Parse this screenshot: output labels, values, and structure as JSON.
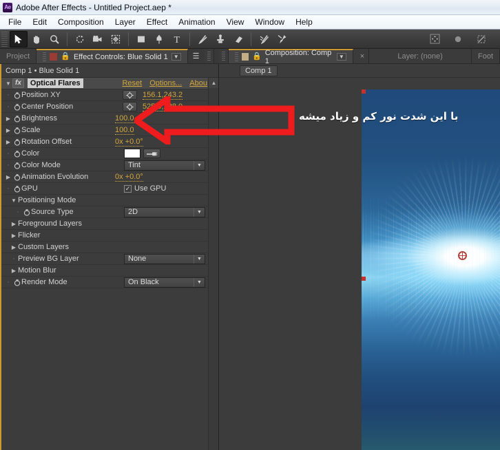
{
  "window": {
    "logo": "Ae",
    "logo_icon": "after-effects-logo-icon",
    "title": "Adobe After Effects - Untitled Project.aep *"
  },
  "menubar": {
    "items": [
      {
        "label": "File"
      },
      {
        "label": "Edit"
      },
      {
        "label": "Composition"
      },
      {
        "label": "Layer"
      },
      {
        "label": "Effect"
      },
      {
        "label": "Animation"
      },
      {
        "label": "View"
      },
      {
        "label": "Window"
      },
      {
        "label": "Help"
      }
    ]
  },
  "toolbar": {
    "tools": [
      {
        "name": "selection-tool-icon",
        "selected": true
      },
      {
        "name": "hand-tool-icon",
        "selected": false
      },
      {
        "name": "zoom-tool-icon",
        "selected": false
      },
      {
        "name": "rotation-tool-icon",
        "selected": false
      },
      {
        "name": "camera-orbit-tool-icon",
        "selected": false
      },
      {
        "name": "pan-behind-tool-icon",
        "selected": false
      },
      {
        "name": "shape-tool-icon",
        "selected": false
      },
      {
        "name": "pen-tool-icon",
        "selected": false
      },
      {
        "name": "type-tool-icon",
        "selected": false
      },
      {
        "name": "brush-tool-icon",
        "selected": false
      },
      {
        "name": "clone-stamp-tool-icon",
        "selected": false
      },
      {
        "name": "eraser-tool-icon",
        "selected": false
      },
      {
        "name": "roto-brush-tool-icon",
        "selected": false
      },
      {
        "name": "puppet-pin-tool-icon",
        "selected": false
      }
    ],
    "right_icons": [
      {
        "name": "transform-snapping-icon"
      },
      {
        "name": "grid-dot-icon"
      },
      {
        "name": "toggle-mask-icon"
      }
    ]
  },
  "left_panel": {
    "tabs": [
      {
        "label": "Project",
        "active": false,
        "name": "tab-project"
      },
      {
        "label": "Effect Controls: Blue Solid 1",
        "active": true,
        "name": "tab-effect-controls"
      }
    ],
    "breadcrumb": "Comp 1 • Blue Solid 1",
    "effect": {
      "name": "Optical Flares",
      "fx_badge": "fx",
      "twirl": "▼",
      "links": [
        {
          "label": "Reset"
        },
        {
          "label": "Options..."
        },
        {
          "label": "Abou"
        }
      ],
      "properties": [
        {
          "label": "Position XY",
          "indent": 1,
          "marker": "dot",
          "stopwatch": true,
          "control": "xy",
          "value": "156.1,243.2"
        },
        {
          "label": "Center Position",
          "indent": 1,
          "marker": "dot",
          "stopwatch": true,
          "control": "xy",
          "value": "525.0,288.0"
        },
        {
          "label": "Brightness",
          "indent": 1,
          "marker": "twirl",
          "stopwatch": true,
          "control": "value",
          "value": "100.0"
        },
        {
          "label": "Scale",
          "indent": 1,
          "marker": "twirl",
          "stopwatch": true,
          "control": "value",
          "value": "100.0"
        },
        {
          "label": "Rotation Offset",
          "indent": 1,
          "marker": "twirl",
          "stopwatch": true,
          "control": "value",
          "value": "0x +0.0°"
        },
        {
          "label": "Color",
          "indent": 1,
          "marker": "dot",
          "stopwatch": true,
          "control": "color",
          "value": "#ffffff"
        },
        {
          "label": "Color Mode",
          "indent": 1,
          "marker": "dot",
          "stopwatch": true,
          "control": "dropdown",
          "value": "Tint"
        },
        {
          "label": "Animation Evolution",
          "indent": 1,
          "marker": "twirl",
          "stopwatch": true,
          "control": "value",
          "value": "0x +0.0°"
        },
        {
          "label": "GPU",
          "indent": 1,
          "marker": "dot",
          "stopwatch": true,
          "control": "checkbox",
          "value": "Use GPU",
          "checked": true
        },
        {
          "label": "Positioning Mode",
          "indent": 0,
          "marker": "twirl-open",
          "stopwatch": false,
          "control": "none",
          "value": ""
        },
        {
          "label": "Source Type",
          "indent": 2,
          "marker": "dot",
          "stopwatch": true,
          "control": "dropdown",
          "value": "2D"
        },
        {
          "label": "Foreground Layers",
          "indent": 0,
          "marker": "twirl",
          "stopwatch": false,
          "control": "none",
          "value": ""
        },
        {
          "label": "Flicker",
          "indent": 0,
          "marker": "twirl",
          "stopwatch": false,
          "control": "none",
          "value": ""
        },
        {
          "label": "Custom Layers",
          "indent": 0,
          "marker": "twirl",
          "stopwatch": false,
          "control": "none",
          "value": ""
        },
        {
          "label": "Preview BG Layer",
          "indent": 0,
          "marker": "dot",
          "stopwatch": false,
          "control": "dropdown",
          "value": "None"
        },
        {
          "label": "Motion Blur",
          "indent": 0,
          "marker": "twirl",
          "stopwatch": false,
          "control": "none",
          "value": ""
        },
        {
          "label": "Render Mode",
          "indent": 1,
          "marker": "dot",
          "stopwatch": true,
          "control": "dropdown",
          "value": "On Black"
        }
      ]
    },
    "scrollbar": {
      "up_arrow": "▲"
    }
  },
  "right_panel": {
    "tabs": [
      {
        "label": "Composition: Comp 1",
        "active": true,
        "name": "tab-composition"
      },
      {
        "label": "Layer: (none)",
        "active": false,
        "name": "tab-layer"
      },
      {
        "label": "Foot",
        "active": false,
        "name": "tab-footage"
      }
    ],
    "close_glyph": "×",
    "breadcrumb_chip": "Comp 1"
  },
  "annotation": {
    "text": "با این شدت نور کم و زیاد میشه",
    "arrow_color": "#ee1c1c",
    "arrow_direction": "left"
  },
  "colors": {
    "accent_orange": "#cc9a2e",
    "value_orange": "#d4a73c",
    "panel_bg": "#3c3c3c",
    "annotation_red": "#ee1c1c",
    "handle_red": "#c8302a"
  }
}
